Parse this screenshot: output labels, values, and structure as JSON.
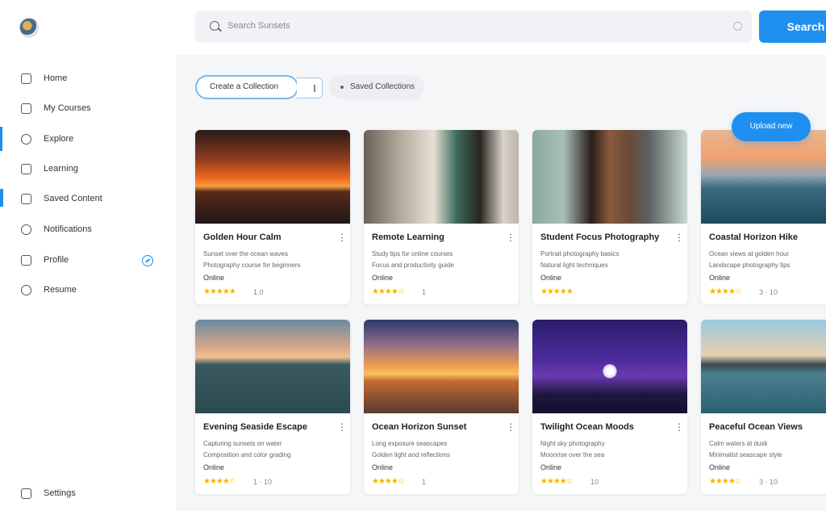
{
  "header": {
    "search_placeholder": "Search Sunsets",
    "search_button": "Search"
  },
  "sidebar": {
    "items": [
      {
        "label": "Home",
        "icon": "home-icon"
      },
      {
        "label": "My Courses",
        "icon": "courses-icon"
      },
      {
        "label": "Explore",
        "icon": "explore-icon"
      },
      {
        "label": "Learning",
        "icon": "learning-icon"
      },
      {
        "label": "Saved Content",
        "icon": "saved-icon"
      },
      {
        "label": "Notifications",
        "icon": "notifications-icon"
      },
      {
        "label": "Profile",
        "icon": "profile-icon"
      },
      {
        "label": "Resume",
        "icon": "resume-icon"
      }
    ],
    "bottom_label": "Settings"
  },
  "filters": {
    "primary_chip": "Create a Collection",
    "secondary_chip": "Saved Collections"
  },
  "fab_label": "Upload new",
  "cards": [
    {
      "title": "Golden Hour Calm",
      "desc1": "Sunset over the ocean waves",
      "desc2": "Photography course for beginners",
      "meta": "Online",
      "stars": "★★★★★",
      "count": "1.0"
    },
    {
      "title": "Remote Learning",
      "desc1": "Study tips for online courses",
      "desc2": "Focus and productivity guide",
      "meta": "Online",
      "stars": "★★★★☆",
      "count": "1"
    },
    {
      "title": "Student Focus Photography",
      "desc1": "Portrait photography basics",
      "desc2": "Natural light techniques",
      "meta": "Online",
      "stars": "★★★★★",
      "count": ""
    },
    {
      "title": "Coastal Horizon Hike",
      "desc1": "Ocean views at golden hour",
      "desc2": "Landscape photography tips",
      "meta": "Online",
      "stars": "★★★★☆",
      "count": "3 · 10"
    },
    {
      "title": "Evening Seaside Escape",
      "desc1": "Capturing sunsets on water",
      "desc2": "Composition and color grading",
      "meta": "Online",
      "stars": "★★★★☆",
      "count": "1 · 10"
    },
    {
      "title": "Ocean Horizon Sunset",
      "desc1": "Long exposure seascapes",
      "desc2": "Golden light and reflections",
      "meta": "Online",
      "stars": "★★★★☆",
      "count": "1"
    },
    {
      "title": "Twilight Ocean Moods",
      "desc1": "Night sky photography",
      "desc2": "Moonrise over the sea",
      "meta": "Online",
      "stars": "★★★★☆",
      "count": "10"
    },
    {
      "title": "Peaceful Ocean Views",
      "desc1": "Calm waters at dusk",
      "desc2": "Minimalist seascape style",
      "meta": "Online",
      "stars": "★★★★☆",
      "count": "3 · 10"
    }
  ]
}
